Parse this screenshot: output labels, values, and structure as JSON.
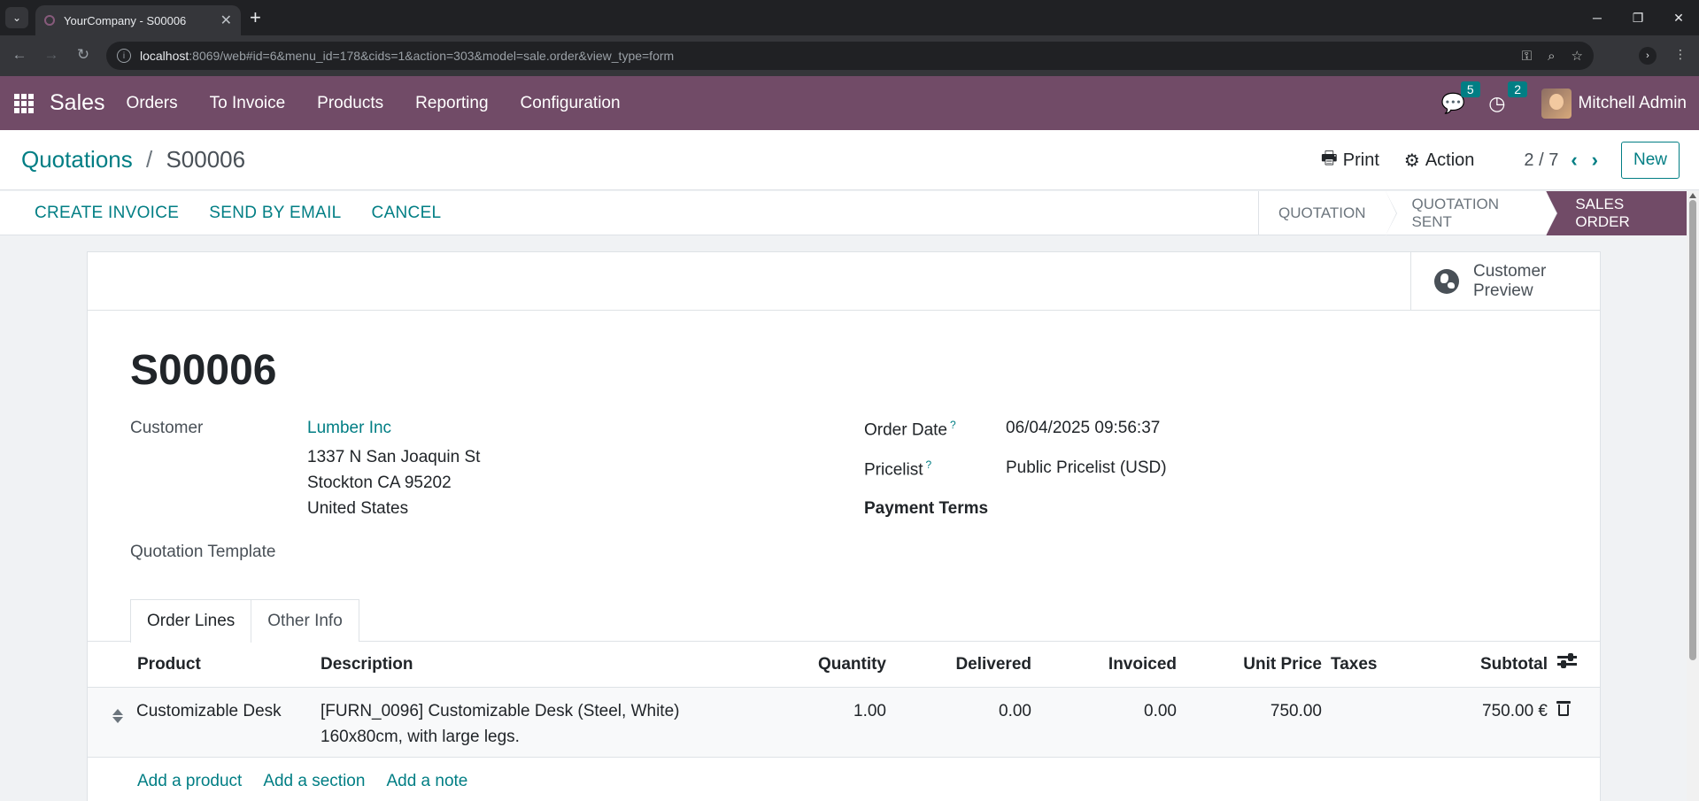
{
  "browser": {
    "tab_title": "YourCompany - S00006",
    "url_host": "localhost",
    "url_rest": ":8069/web#id=6&menu_id=178&cids=1&action=303&model=sale.order&view_type=form"
  },
  "navbar": {
    "app_name": "Sales",
    "menu": [
      "Orders",
      "To Invoice",
      "Products",
      "Reporting",
      "Configuration"
    ],
    "messages_count": "5",
    "activities_count": "2",
    "user_name": "Mitchell Admin",
    "color": "#714b67"
  },
  "control_panel": {
    "breadcrumb_parent": "Quotations",
    "breadcrumb_separator": "/",
    "breadcrumb_current": "S00006",
    "print_label": "Print",
    "action_label": "Action",
    "pager": "2 / 7",
    "new_label": "New"
  },
  "statusbar": {
    "buttons": [
      "CREATE INVOICE",
      "SEND BY EMAIL",
      "CANCEL"
    ],
    "stages": [
      "QUOTATION",
      "QUOTATION SENT",
      "SALES ORDER"
    ],
    "active_stage": "SALES ORDER"
  },
  "form": {
    "preview_label": "Customer Preview",
    "name": "S00006",
    "customer_label": "Customer",
    "customer_name": "Lumber Inc",
    "address": [
      "1337 N San Joaquin St",
      "Stockton CA 95202",
      "United States"
    ],
    "quotation_template_label": "Quotation Template",
    "order_date_label": "Order Date",
    "order_date": "06/04/2025 09:56:37",
    "pricelist_label": "Pricelist",
    "pricelist": "Public Pricelist (USD)",
    "payment_terms_label": "Payment Terms",
    "help_mark": "?",
    "tabs": [
      "Order Lines",
      "Other Info"
    ],
    "columns": {
      "product": "Product",
      "description": "Description",
      "quantity": "Quantity",
      "delivered": "Delivered",
      "invoiced": "Invoiced",
      "unit_price": "Unit Price",
      "taxes": "Taxes",
      "subtotal": "Subtotal"
    },
    "lines": [
      {
        "product": "Customizable Desk",
        "description_1": "[FURN_0096] Customizable Desk (Steel, White)",
        "description_2": "160x80cm, with large legs.",
        "quantity": "1.00",
        "delivered": "0.00",
        "invoiced": "0.00",
        "unit_price": "750.00",
        "subtotal": "750.00 €"
      }
    ],
    "add_links": [
      "Add a product",
      "Add a section",
      "Add a note"
    ],
    "accent_color": "#017e84"
  }
}
